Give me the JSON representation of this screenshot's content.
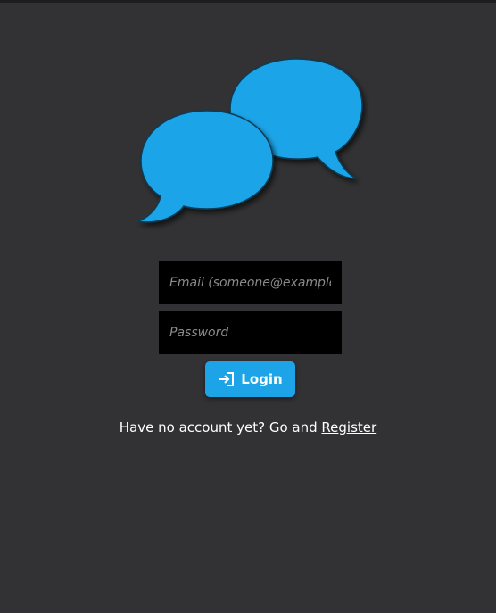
{
  "logo": {
    "icon": "chat-bubbles-icon",
    "color": "#1da4e8"
  },
  "form": {
    "email_placeholder": "Email (someone@example.com)",
    "email_value": "",
    "password_placeholder": "Password",
    "password_value": "",
    "login_label": "Login",
    "login_icon": "sign-in-icon",
    "accent_color": "#1da4e8"
  },
  "footer": {
    "prompt_text": "Have no account yet? Go and",
    "register_label": "Register"
  }
}
